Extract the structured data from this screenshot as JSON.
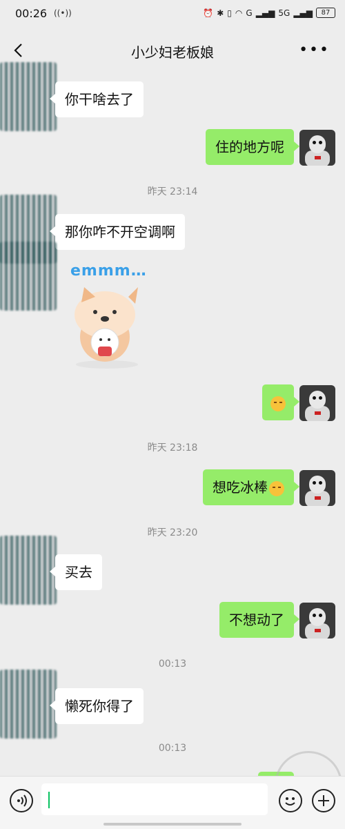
{
  "status_bar": {
    "time": "00:26",
    "signal_icon": "hotspot-icon",
    "battery": "87",
    "net1": "G",
    "net2": "5G"
  },
  "header": {
    "title": "小少妇老板娘",
    "more": "•••"
  },
  "messages": [
    {
      "side": "left",
      "text": "你干啥去了"
    },
    {
      "side": "right",
      "text": "住的地方呢"
    },
    {
      "type": "time",
      "text": "昨天 23:14"
    },
    {
      "side": "left",
      "text": "那你咋不开空调啊"
    },
    {
      "side": "left",
      "type": "sticker",
      "text": "emmm…"
    },
    {
      "side": "right",
      "type": "emoji",
      "icon": "kissing-face-icon"
    },
    {
      "type": "time",
      "text": "昨天 23:18"
    },
    {
      "side": "right",
      "text": "想吃冰棒"
    },
    {
      "type": "time",
      "text": "昨天 23:20"
    },
    {
      "side": "left",
      "text": "买去"
    },
    {
      "side": "right",
      "text": "不想动了"
    },
    {
      "type": "time",
      "text": "00:13"
    },
    {
      "side": "left",
      "text": "懒死你得了"
    },
    {
      "type": "time",
      "text": "00:13"
    }
  ],
  "colors": {
    "background": "#ededed",
    "right_bubble": "#95ec69",
    "left_bubble": "#ffffff",
    "timestamp": "#8a8a8a"
  }
}
